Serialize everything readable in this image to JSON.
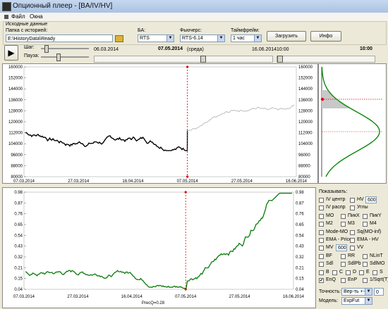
{
  "window": {
    "title": "Опционный плеер - [BA/IV/HV]"
  },
  "menu": {
    "file": "Файл",
    "windows": "Окна"
  },
  "source": {
    "group_label": "Исходные данные",
    "folder_label": "Папка с историей:",
    "folder_value": "E:\\HistoryData\\Ready",
    "ba_label": "БА:",
    "ba_value": "RTS",
    "futures_label": "Фьючерс:",
    "futures_value": "RTS-6.14",
    "timeframe_label": "Таймфрейм:",
    "timeframe_value": "1 час",
    "load_button": "Загрузить",
    "info_button": "Инфо"
  },
  "player": {
    "step_label": "Шаг:",
    "pause_label": "Пауза:",
    "start_date": "06.03.2014",
    "current_date": "07.05.2014",
    "current_day": "(среда)",
    "end_date": "16.06.2014",
    "time_start": "10:00",
    "time_current": "10:00"
  },
  "price_chart": {
    "y_ticks": [
      "160000",
      "152000",
      "144000",
      "136000",
      "128000",
      "120000",
      "112000",
      "104000",
      "96000",
      "88000",
      "80000"
    ],
    "x_ticks": [
      "07.03.2014",
      "27.03.2014",
      "16.04.2014",
      "07.05.2014",
      "27.05.2014",
      "16.06.2014"
    ]
  },
  "vol_chart": {
    "y_ticks": [
      "0.98",
      "0.87",
      "0.76",
      "0.65",
      "0.54",
      "0.43",
      "0.32",
      "0.21",
      "0.15",
      "0.04"
    ],
    "x_ticks": [
      "07.03.2014",
      "27.03.2014",
      "16.04.2014",
      "07.05.2014",
      "27.05.2014",
      "16.06.2014"
    ],
    "footer": "PrecQ=0.28"
  },
  "show_panel": {
    "title": "Показывать:",
    "rows": [
      [
        {
          "label": "IV центр",
          "checked": false
        },
        {
          "label": "HV",
          "checked": false,
          "value": "600"
        }
      ],
      [
        {
          "label": "IV распр",
          "checked": false
        },
        {
          "label": "Углы",
          "checked": false
        }
      ],
      [
        {
          "label": "MO",
          "checked": false
        },
        {
          "label": "ПикX",
          "checked": false
        },
        {
          "label": "ПикY",
          "checked": false
        }
      ],
      [
        {
          "label": "M2",
          "checked": false
        },
        {
          "label": "M3",
          "checked": false
        },
        {
          "label": "M4",
          "checked": false
        }
      ],
      [
        {
          "label": "Mode-MO",
          "checked": false
        },
        {
          "label": "Sq(MO-inf)",
          "checked": false
        }
      ],
      [
        {
          "label": "EMA - Price",
          "checked": false
        },
        {
          "label": "EMA - HV",
          "checked": false
        }
      ],
      [
        {
          "label": "MV",
          "checked": false,
          "value": "600"
        },
        {
          "label": "VV",
          "checked": false
        }
      ],
      [
        {
          "label": "BF",
          "checked": false
        },
        {
          "label": "RR",
          "checked": false
        },
        {
          "label": "NLinT",
          "checked": false
        }
      ],
      [
        {
          "label": "Sdl",
          "checked": false
        },
        {
          "label": "SdlPb",
          "checked": false
        },
        {
          "label": "SdlMO",
          "checked": false
        }
      ],
      [
        {
          "label": "B",
          "checked": false
        },
        {
          "label": "C",
          "checked": false
        },
        {
          "label": "D",
          "checked": false
        },
        {
          "label": "E",
          "checked": false
        },
        {
          "label": "S",
          "checked": false
        }
      ],
      [
        {
          "label": "EnQ",
          "checked": true
        },
        {
          "label": "EnP",
          "checked": false
        },
        {
          "label": "1/Sqrt(T)",
          "checked": false
        }
      ]
    ],
    "precision_label": "Точность:",
    "precision_value": "Вер-ть +-1",
    "precision_num": "0",
    "model_label": "Модель:",
    "model_value": "ExpFut"
  },
  "colors": {
    "price_line": "#000000",
    "future_line": "#b8b8b8",
    "vol_line": "#0a7a0a",
    "marker": "#e00000",
    "dist_line": "#0a8a0a"
  }
}
